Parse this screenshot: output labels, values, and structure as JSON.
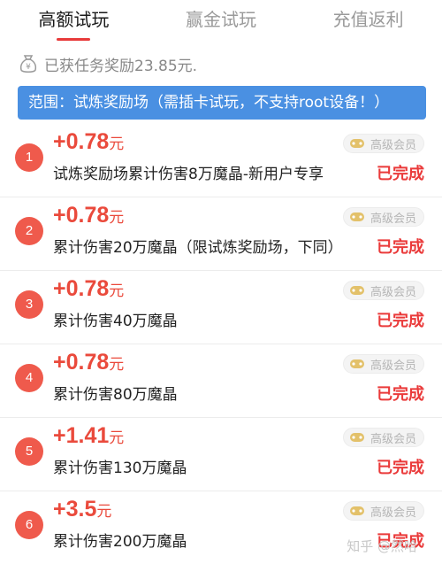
{
  "tabs": [
    {
      "label": "高额试玩",
      "active": true
    },
    {
      "label": "赢金试玩",
      "active": false
    },
    {
      "label": "充值返利",
      "active": false
    }
  ],
  "reward_summary": {
    "icon": "money-bag-icon",
    "text": "已获任务奖励23.85元."
  },
  "banner": {
    "text": "范围：试炼奖励场（需插卡试玩，不支持root设备！）"
  },
  "tasks": [
    {
      "num": "1",
      "amount": "+0.78",
      "unit": "元",
      "desc": "试炼奖励场累计伤害8万魔晶-新用户专享",
      "badge": "高级会员",
      "status": "已完成"
    },
    {
      "num": "2",
      "amount": "+0.78",
      "unit": "元",
      "desc": "累计伤害20万魔晶（限试炼奖励场，下同）",
      "badge": "高级会员",
      "status": "已完成"
    },
    {
      "num": "3",
      "amount": "+0.78",
      "unit": "元",
      "desc": "累计伤害40万魔晶",
      "badge": "高级会员",
      "status": "已完成"
    },
    {
      "num": "4",
      "amount": "+0.78",
      "unit": "元",
      "desc": "累计伤害80万魔晶",
      "badge": "高级会员",
      "status": "已完成"
    },
    {
      "num": "5",
      "amount": "+1.41",
      "unit": "元",
      "desc": "累计伤害130万魔晶",
      "badge": "高级会员",
      "status": "已完成"
    },
    {
      "num": "6",
      "amount": "+3.5",
      "unit": "元",
      "desc": "累计伤害200万魔晶",
      "badge": "高级会员",
      "status": "已完成"
    }
  ],
  "watermark": "知乎 @然哈",
  "colors": {
    "accent": "#ea4a3c",
    "banner": "#4a90e2",
    "number_circle": "#ef5a4c"
  }
}
